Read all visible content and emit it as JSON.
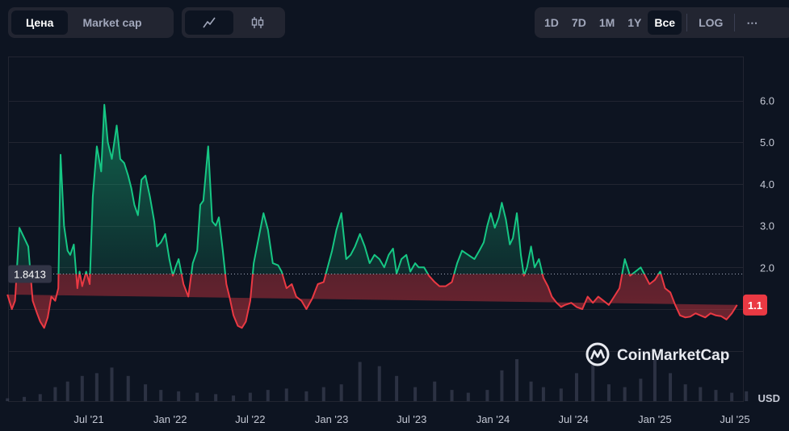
{
  "tabs": {
    "type": [
      {
        "label": "Цена",
        "active": true
      },
      {
        "label": "Market cap",
        "active": false
      }
    ],
    "view": [
      {
        "icon": "line-chart-icon",
        "active": true
      },
      {
        "icon": "candlestick-chart-icon",
        "active": false
      }
    ],
    "range": [
      {
        "label": "1D",
        "active": false
      },
      {
        "label": "7D",
        "active": false
      },
      {
        "label": "1M",
        "active": false
      },
      {
        "label": "1Y",
        "active": false
      },
      {
        "label": "Все",
        "active": true
      }
    ],
    "log_label": "LOG",
    "more_icon": "more-horizontal-icon"
  },
  "colors": {
    "above": "#16c784",
    "below": "#ea3943",
    "background": "#0d1421",
    "grid": "#222531"
  },
  "watermark": {
    "text": "CoinMarketCap",
    "icon": "coinmarketcap-logo-icon"
  },
  "chart_data": {
    "type": "area",
    "title": "",
    "xlabel": "",
    "ylabel": "USD",
    "ylim": [
      0,
      7
    ],
    "yticks": [
      2.0,
      3.0,
      4.0,
      5.0,
      6.0
    ],
    "ytick_labels": [
      "2.0",
      "3.0",
      "4.0",
      "5.0",
      "6.0"
    ],
    "xticks": [
      "2021-07-01",
      "2022-01-01",
      "2022-07-01",
      "2023-01-01",
      "2023-07-01",
      "2024-01-01",
      "2024-07-01",
      "2025-01-01",
      "2025-07-01"
    ],
    "xtick_labels": [
      "Jul '21",
      "Jan '22",
      "Jul '22",
      "Jan '23",
      "Jul '23",
      "Jan '24",
      "Jul '24",
      "Jan '25",
      "Jul '25"
    ],
    "grid": true,
    "reference_value": 1.8413,
    "reference_label": "1.8413",
    "current_value": 1.1,
    "current_label": "1.1",
    "x": [
      "2020-12-29",
      "2021-01-08",
      "2021-01-15",
      "2021-01-25",
      "2021-02-05",
      "2021-02-14",
      "2021-02-24",
      "2021-03-06",
      "2021-03-13",
      "2021-03-22",
      "2021-03-30",
      "2021-04-07",
      "2021-04-16",
      "2021-04-23",
      "2021-04-28",
      "2021-05-06",
      "2021-05-14",
      "2021-05-20",
      "2021-05-28",
      "2021-06-05",
      "2021-06-10",
      "2021-06-16",
      "2021-06-25",
      "2021-07-03",
      "2021-07-10",
      "2021-07-19",
      "2021-07-29",
      "2021-08-05",
      "2021-08-13",
      "2021-08-22",
      "2021-09-02",
      "2021-09-10",
      "2021-09-19",
      "2021-09-28",
      "2021-10-05",
      "2021-10-12",
      "2021-10-20",
      "2021-10-28",
      "2021-11-06",
      "2021-11-16",
      "2021-11-26",
      "2021-12-02",
      "2021-12-11",
      "2021-12-21",
      "2021-12-30",
      "2022-01-07",
      "2022-01-13",
      "2022-01-20",
      "2022-01-31",
      "2022-02-11",
      "2022-02-21",
      "2022-03-03",
      "2022-03-10",
      "2022-03-17",
      "2022-03-28",
      "2022-04-06",
      "2022-04-14",
      "2022-04-21",
      "2022-04-30",
      "2022-05-08",
      "2022-05-15",
      "2022-05-24",
      "2022-06-03",
      "2022-06-12",
      "2022-06-21",
      "2022-07-01",
      "2022-07-09",
      "2022-07-18",
      "2022-07-31",
      "2022-08-10",
      "2022-08-21",
      "2022-09-02",
      "2022-09-10",
      "2022-09-21",
      "2022-10-03",
      "2022-10-13",
      "2022-10-25",
      "2022-11-05",
      "2022-11-18",
      "2022-12-01",
      "2022-12-14",
      "2022-12-23",
      "2023-01-02",
      "2023-01-12",
      "2023-01-23",
      "2023-02-03",
      "2023-02-13",
      "2023-02-23",
      "2023-03-06",
      "2023-03-17",
      "2023-03-28",
      "2023-04-08",
      "2023-04-19",
      "2023-04-30",
      "2023-05-10",
      "2023-05-20",
      "2023-05-28",
      "2023-06-08",
      "2023-06-19",
      "2023-06-28",
      "2023-07-09",
      "2023-07-17",
      "2023-07-29",
      "2023-08-09",
      "2023-08-22",
      "2023-09-02",
      "2023-09-16",
      "2023-09-30",
      "2023-10-12",
      "2023-10-23",
      "2023-11-06",
      "2023-11-20",
      "2023-12-01",
      "2023-12-11",
      "2023-12-19",
      "2023-12-27",
      "2024-01-05",
      "2024-01-14",
      "2024-01-21",
      "2024-01-30",
      "2024-02-08",
      "2024-02-15",
      "2024-02-24",
      "2024-03-04",
      "2024-03-11",
      "2024-03-18",
      "2024-03-27",
      "2024-04-04",
      "2024-04-14",
      "2024-04-24",
      "2024-05-04",
      "2024-05-13",
      "2024-05-24",
      "2024-06-03",
      "2024-06-12",
      "2024-06-26",
      "2024-07-08",
      "2024-07-21",
      "2024-08-02",
      "2024-08-14",
      "2024-08-26",
      "2024-09-07",
      "2024-09-19",
      "2024-10-01",
      "2024-10-13",
      "2024-10-25",
      "2024-11-06",
      "2024-11-18",
      "2024-11-30",
      "2024-12-10",
      "2024-12-20",
      "2025-01-01",
      "2025-01-13",
      "2025-01-24",
      "2025-02-05",
      "2025-02-16",
      "2025-02-27",
      "2025-03-11",
      "2025-03-22",
      "2025-04-03",
      "2025-04-14",
      "2025-04-25",
      "2025-05-07",
      "2025-05-19",
      "2025-05-31",
      "2025-06-12",
      "2025-06-24",
      "2025-07-06",
      "2025-07-18",
      "2025-07-27"
    ],
    "y": [
      1.35,
      1.0,
      1.2,
      2.95,
      2.7,
      2.5,
      1.2,
      0.9,
      0.7,
      0.55,
      0.8,
      1.3,
      1.2,
      1.5,
      4.7,
      3.0,
      2.4,
      2.3,
      2.55,
      1.5,
      1.9,
      1.55,
      1.9,
      1.6,
      3.7,
      4.9,
      4.3,
      5.9,
      5.0,
      4.6,
      5.4,
      4.6,
      4.5,
      4.2,
      3.9,
      3.5,
      3.25,
      4.1,
      4.2,
      3.7,
      3.1,
      2.5,
      2.6,
      2.8,
      2.2,
      1.8,
      2.0,
      2.2,
      1.6,
      1.3,
      2.1,
      2.4,
      3.5,
      3.6,
      4.9,
      3.1,
      3.0,
      3.2,
      2.4,
      1.6,
      1.3,
      0.85,
      0.6,
      0.55,
      0.7,
      1.2,
      2.1,
      2.6,
      3.3,
      2.9,
      2.1,
      2.05,
      1.9,
      1.5,
      1.6,
      1.3,
      1.2,
      1.0,
      1.25,
      1.6,
      1.65,
      2.0,
      2.4,
      2.9,
      3.3,
      2.2,
      2.3,
      2.5,
      2.8,
      2.5,
      2.1,
      2.3,
      2.2,
      2.0,
      2.3,
      2.45,
      1.85,
      2.2,
      2.3,
      1.9,
      2.1,
      2.0,
      2.0,
      1.8,
      1.65,
      1.55,
      1.55,
      1.65,
      2.1,
      2.4,
      2.3,
      2.2,
      2.4,
      2.6,
      3.0,
      3.3,
      2.95,
      3.2,
      3.55,
      3.15,
      2.55,
      2.7,
      3.3,
      2.3,
      1.8,
      2.0,
      2.5,
      2.0,
      2.2,
      1.75,
      1.55,
      1.3,
      1.15,
      1.05,
      1.1,
      1.15,
      1.05,
      1.0,
      1.3,
      1.15,
      1.3,
      1.2,
      1.1,
      1.3,
      1.5,
      2.2,
      1.8,
      1.9,
      2.0,
      1.8,
      1.6,
      1.7,
      1.9,
      1.5,
      1.4,
      1.1,
      0.85,
      0.8,
      0.82,
      0.9,
      0.85,
      0.8,
      0.9,
      0.85,
      0.83,
      0.75,
      0.9,
      1.1
    ],
    "volume_series": {
      "name": "Volume",
      "x": [
        "2020-12-29",
        "2021-02-05",
        "2021-03-13",
        "2021-04-16",
        "2021-05-14",
        "2021-06-16",
        "2021-07-19",
        "2021-08-22",
        "2021-09-28",
        "2021-11-06",
        "2021-12-11",
        "2022-01-20",
        "2022-03-03",
        "2022-04-14",
        "2022-05-24",
        "2022-07-01",
        "2022-08-10",
        "2022-09-21",
        "2022-11-05",
        "2022-12-14",
        "2023-01-23",
        "2023-03-06",
        "2023-04-19",
        "2023-05-28",
        "2023-07-09",
        "2023-08-22",
        "2023-09-30",
        "2023-11-06",
        "2023-12-19",
        "2024-01-21",
        "2024-02-24",
        "2024-03-27",
        "2024-04-24",
        "2024-06-03",
        "2024-07-08",
        "2024-08-14",
        "2024-09-19",
        "2024-10-25",
        "2024-11-30",
        "2025-01-01",
        "2025-02-05",
        "2025-03-11",
        "2025-04-14",
        "2025-05-19",
        "2025-06-24",
        "2025-07-27"
      ],
      "values": [
        2,
        3,
        5,
        10,
        14,
        18,
        20,
        24,
        18,
        12,
        8,
        7,
        6,
        5,
        4,
        6,
        8,
        9,
        7,
        10,
        12,
        28,
        25,
        18,
        10,
        14,
        8,
        6,
        8,
        22,
        30,
        14,
        10,
        9,
        20,
        26,
        12,
        10,
        16,
        30,
        20,
        12,
        10,
        8,
        6,
        7
      ]
    }
  }
}
